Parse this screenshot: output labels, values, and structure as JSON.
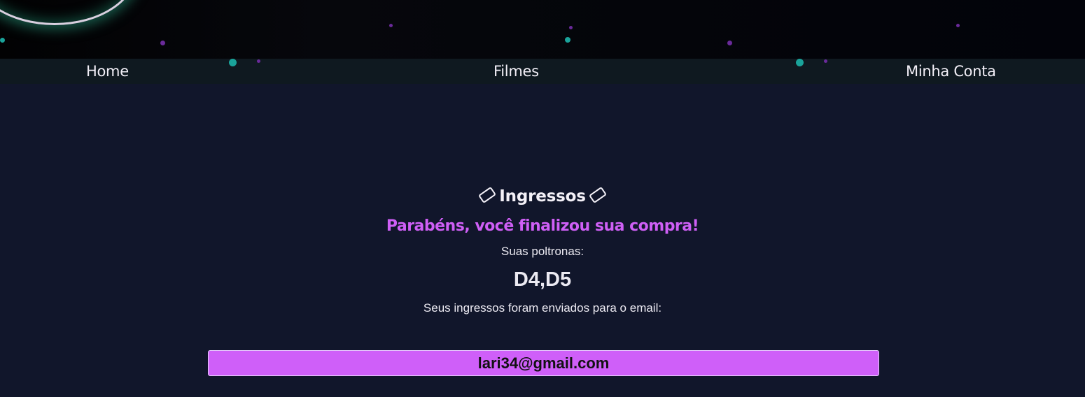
{
  "nav": {
    "home": "Home",
    "filmes": "Filmes",
    "conta": "Minha Conta"
  },
  "main": {
    "title": "Ingressos",
    "congrats": "Parabéns, você finalizou sua compra!",
    "seats_label": "Suas poltronas:",
    "seats": "D4,D5",
    "email_label": "Seus ingressos foram enviados para o email:",
    "email": "lari34@gmail.com"
  },
  "icons": {
    "title_left": "ticket-icon",
    "title_right": "ticket-icon"
  },
  "colors": {
    "background": "#11162b",
    "nav_bar": "#0f1920",
    "accent": "#cf5ff6",
    "text": "#f1eef6",
    "banner_dot_teal": "#1aa39a",
    "banner_dot_purple": "#6a2a9a"
  }
}
